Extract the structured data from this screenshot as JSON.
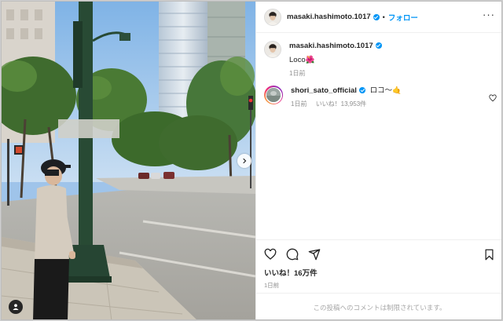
{
  "post": {
    "username": "masaki.hashimoto.1017",
    "follow_label": "フォロー",
    "separator": "•",
    "more_label": "···"
  },
  "caption": {
    "username": "masaki.hashimoto.1017",
    "text": "Loco🌺",
    "time": "1日前"
  },
  "comments": [
    {
      "username": "shori_sato_official",
      "text": "ロコ〜🤙",
      "time": "1日前",
      "likes": "いいね！13,953件"
    }
  ],
  "footer": {
    "likes": "いいね！16万件",
    "date": "1日前",
    "comments_disabled": "この投稿へのコメントは制限されています。"
  },
  "colors": {
    "accent": "#0095f6",
    "verified": "#0095f6",
    "muted": "#8e8e8e"
  },
  "icons": [
    "user-tag-icon",
    "next-arrow-icon",
    "more-options-icon",
    "verified-icon",
    "heart-icon",
    "comment-icon",
    "share-icon",
    "bookmark-icon"
  ]
}
